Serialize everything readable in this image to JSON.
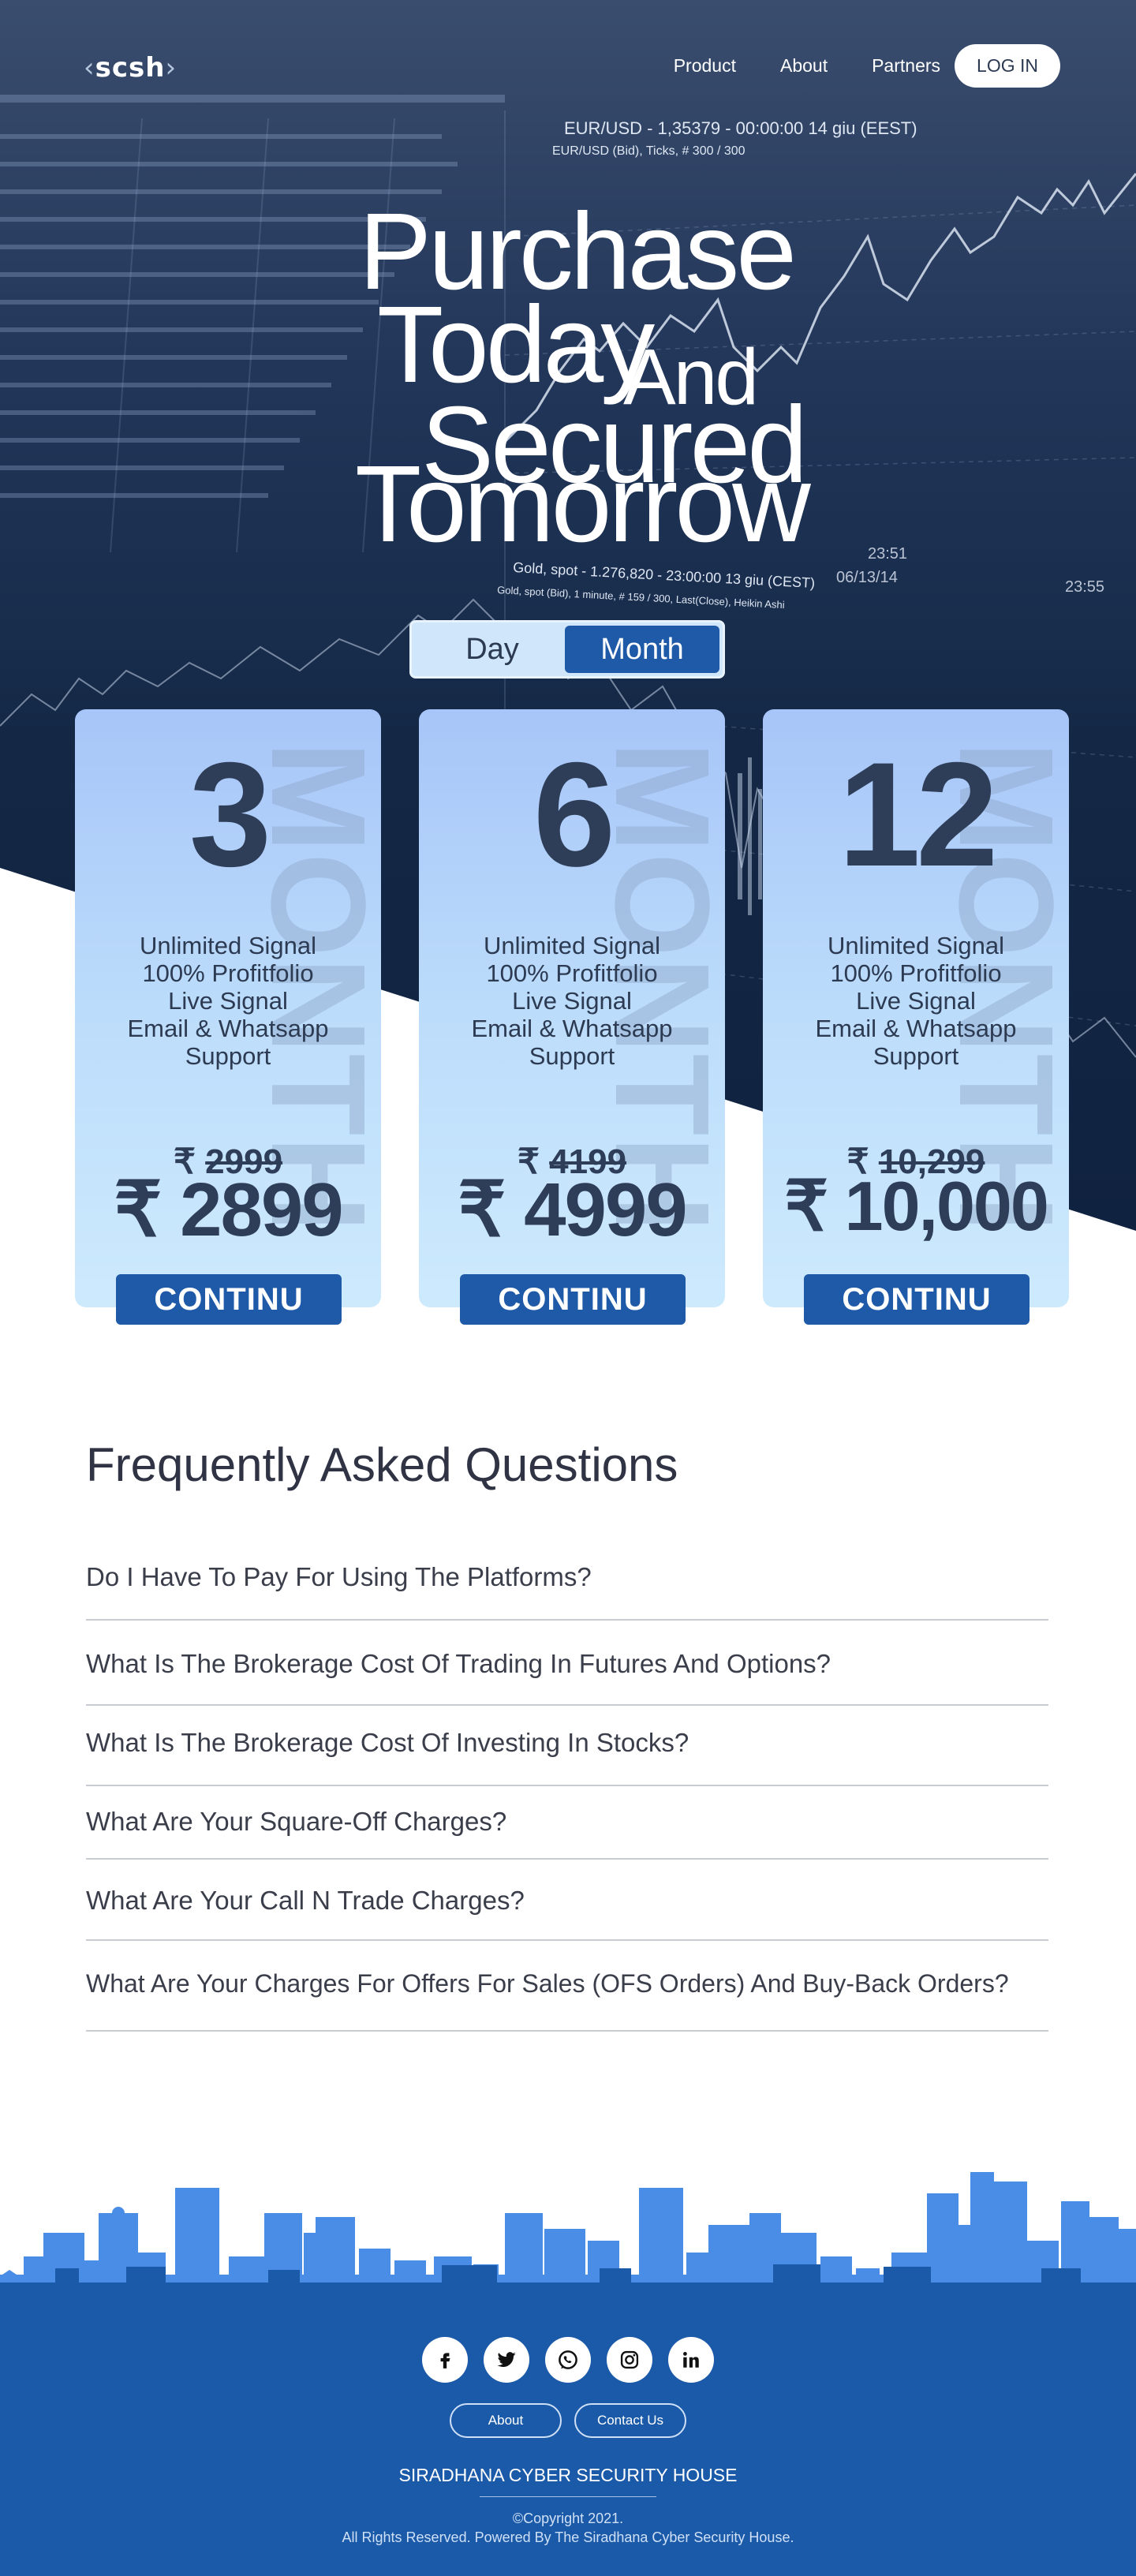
{
  "brand": {
    "logo": "scsh"
  },
  "nav": {
    "items": [
      "Product",
      "About",
      "Partners"
    ],
    "login": "LOG IN"
  },
  "hero": {
    "line1": "Purchase",
    "line2": "Today",
    "line3": "And",
    "line4": "Secured",
    "line5": "Tomorrow",
    "chart_text": [
      "EUR/USD - 1,35379 - 00:00:00  14 giu (EEST)",
      "EUR/USD (Bid), Ticks, # 300 / 300",
      "Gold, spot - 1.276,820 - 23:00:00  13 giu (CEST)",
      "Gold, spot (Bid), 1 minute, # 159 / 300, Last(Close), Heikin Ashi"
    ]
  },
  "toggle": {
    "day": "Day",
    "month": "Month",
    "selected": "Month"
  },
  "watermark_text": "MONTH",
  "plans": [
    {
      "months": "3",
      "features": [
        "Unlimited Signal",
        "100% Profitfolio",
        "Live Signal",
        "Email & Whatsapp",
        "Support"
      ],
      "currency": "₹",
      "old_price": "2999",
      "price": "2899",
      "button": "CONTINU"
    },
    {
      "months": "6",
      "features": [
        "Unlimited Signal",
        "100% Profitfolio",
        "Live Signal",
        "Email & Whatsapp",
        "Support"
      ],
      "currency": "₹",
      "old_price": "4199",
      "price": "4999",
      "button": "CONTINU"
    },
    {
      "months": "12",
      "features": [
        "Unlimited Signal",
        "100% Profitfolio",
        "Live Signal",
        "Email & Whatsapp",
        "Support"
      ],
      "currency": "₹",
      "old_price": "10,299",
      "price": "10,000",
      "button": "CONTINU"
    }
  ],
  "faq": {
    "title": "Frequently Asked Questions",
    "items": [
      "Do I Have To Pay For Using The Platforms?",
      "What Is The Brokerage Cost Of Trading In Futures And Options?",
      "What Is The Brokerage Cost Of Investing In Stocks?",
      "What Are Your Square-Off Charges?",
      "What Are Your Call N Trade Charges?",
      "What Are Your Charges For Offers For Sales (OFS Orders) And Buy-Back Orders?"
    ]
  },
  "footer": {
    "socials": [
      "facebook-icon",
      "twitter-icon",
      "whatsapp-icon",
      "instagram-icon",
      "linkedin-icon"
    ],
    "buttons": [
      "About",
      "Contact Us"
    ],
    "company": "SIRADHANA CYBER SECURITY HOUSE",
    "copyright": "©Copyright 2021.",
    "rights": "All Rights Reserved. Powered By The Siradhana Cyber Security House."
  },
  "colors": {
    "hero_dark": "#142846",
    "accent_blue": "#1f5aa8",
    "card_top": "#a7c5f8",
    "card_bottom": "#cdeafd",
    "footer_blue": "#1b5aa8",
    "skyline_blue": "#4a8de6"
  }
}
